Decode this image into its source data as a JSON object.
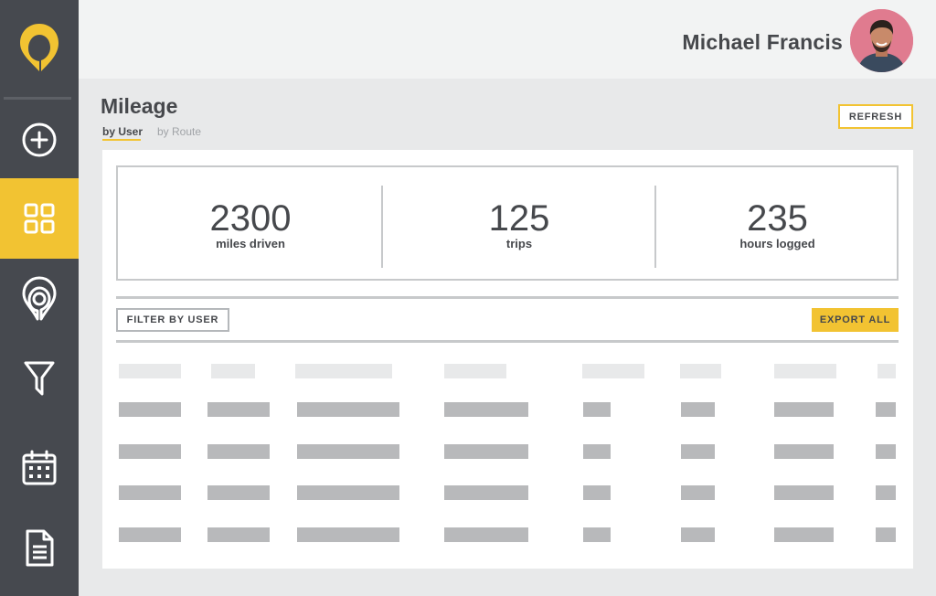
{
  "header": {
    "user_name": "Michael Francis"
  },
  "sidebar": {
    "items": [
      {
        "icon": "plus-circle-icon"
      },
      {
        "icon": "grid-icon",
        "active": true
      },
      {
        "icon": "location-pin-icon"
      },
      {
        "icon": "filter-icon"
      },
      {
        "icon": "calendar-icon"
      },
      {
        "icon": "document-icon"
      }
    ]
  },
  "page": {
    "title": "Mileage",
    "tabs": [
      {
        "label": "by User",
        "active": true
      },
      {
        "label": "by Route",
        "active": false
      }
    ],
    "refresh_label": "REFRESH"
  },
  "stats": [
    {
      "value": "2300",
      "label": "miles driven"
    },
    {
      "value": "125",
      "label": "trips"
    },
    {
      "value": "235",
      "label": "hours logged"
    }
  ],
  "toolbar": {
    "filter_label": "FILTER BY USER",
    "export_label": "EXPORT ALL"
  },
  "colors": {
    "accent": "#f2c332",
    "sidebar": "#46494f",
    "text": "#46484c"
  }
}
